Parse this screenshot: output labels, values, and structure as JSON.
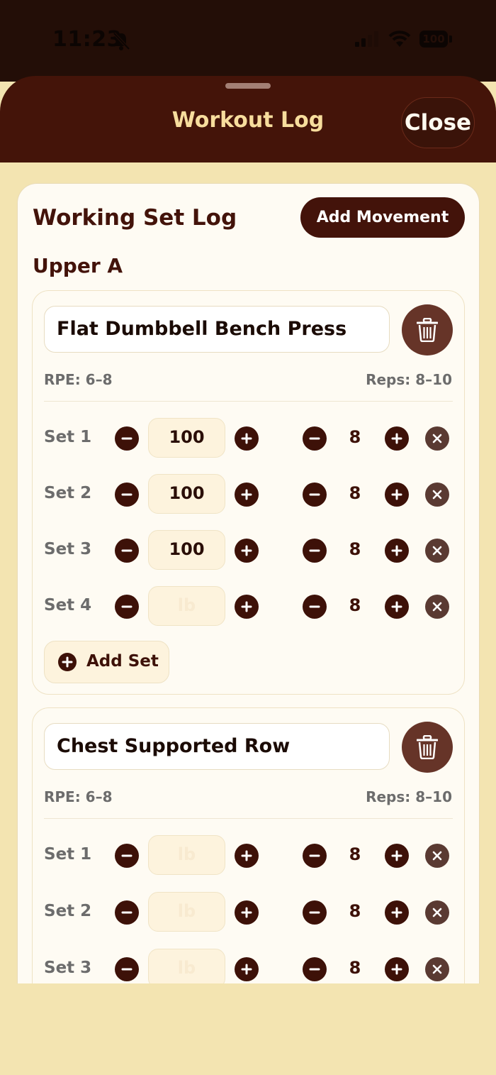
{
  "status": {
    "time": "11:23",
    "battery": "100"
  },
  "sheet": {
    "title": "Workout Log",
    "close_label": "Close"
  },
  "log": {
    "title": "Working Set Log",
    "add_movement_label": "Add Movement",
    "day": "Upper A"
  },
  "exercises": [
    {
      "name": "Flat Dumbbell Bench Press",
      "rpe": "RPE: 6–8",
      "reps_range": "Reps: 8–10",
      "sets": [
        {
          "label": "Set 1",
          "weight": "100",
          "reps": "8"
        },
        {
          "label": "Set 2",
          "weight": "100",
          "reps": "8"
        },
        {
          "label": "Set 3",
          "weight": "100",
          "reps": "8"
        },
        {
          "label": "Set 4",
          "weight_placeholder": "lb",
          "reps": "8"
        }
      ],
      "add_set_label": "Add Set"
    },
    {
      "name": "Chest Supported Row",
      "rpe": "RPE: 6–8",
      "reps_range": "Reps: 8–10",
      "sets": [
        {
          "label": "Set 1",
          "weight_placeholder": "lb",
          "reps": "8"
        },
        {
          "label": "Set 2",
          "weight_placeholder": "lb",
          "reps": "8"
        },
        {
          "label": "Set 3",
          "weight_placeholder": "lb",
          "reps": "8"
        }
      ]
    }
  ],
  "colors": {
    "primary": "#43130a",
    "header": "#441409",
    "background": "#f3e4b1",
    "title_accent": "#f7dd9d"
  }
}
